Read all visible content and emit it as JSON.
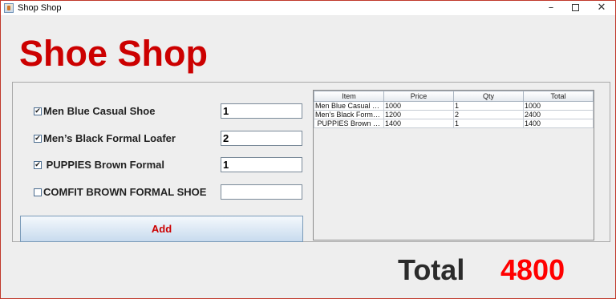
{
  "window": {
    "title": "Shop Shop",
    "minimize_glyph": "–",
    "close_glyph": "✕"
  },
  "heading": "Shoe Shop",
  "items": [
    {
      "label": "Men Blue Casual Shoe",
      "checked": true,
      "qty": "1"
    },
    {
      "label": "Men’s Black Formal Loafer",
      "checked": true,
      "qty": "2"
    },
    {
      "label": " PUPPIES Brown Formal",
      "checked": true,
      "qty": "1"
    },
    {
      "label": "COMFIT BROWN FORMAL SHOE",
      "checked": false,
      "qty": ""
    }
  ],
  "add_button_label": "Add",
  "table": {
    "headers": [
      "Item",
      "Price",
      "Qty",
      "Total"
    ],
    "rows": [
      [
        "Men Blue Casual Sh...",
        "1000",
        "1",
        "1000"
      ],
      [
        "Men’s Black Formal ...",
        "1200",
        "2",
        "2400"
      ],
      [
        " PUPPIES Brown Fo...",
        "1400",
        "1",
        "1400"
      ]
    ]
  },
  "total": {
    "label": "Total",
    "value": "4800"
  },
  "colors": {
    "accent_red": "#cc0000",
    "total_red": "#ff0000"
  }
}
